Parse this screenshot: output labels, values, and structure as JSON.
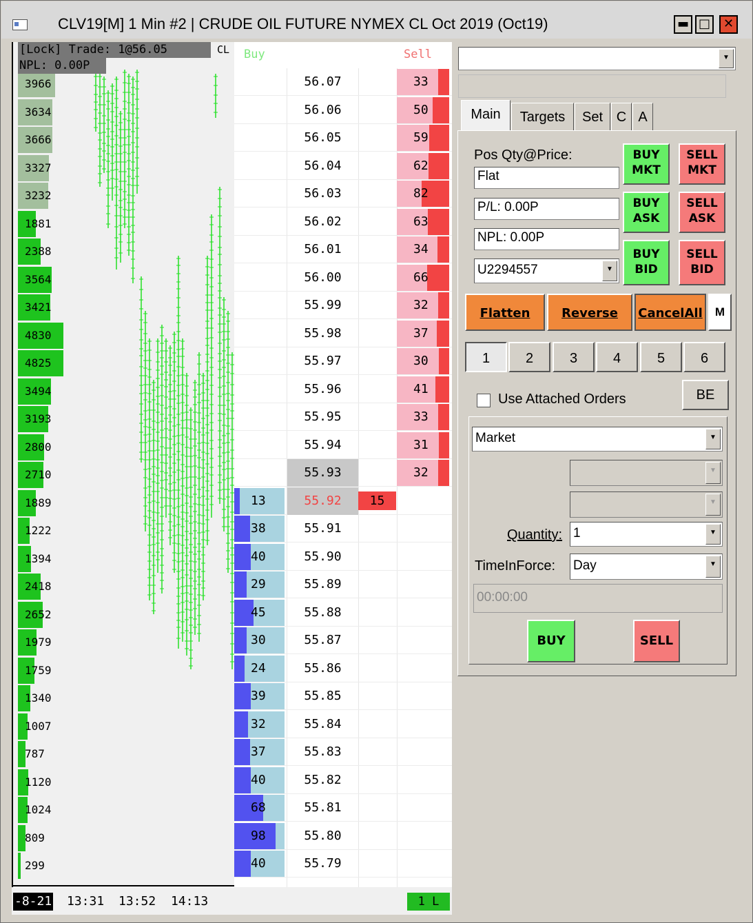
{
  "window": {
    "title": "CLV19[M]  1 Min   #2 | CRUDE OIL FUTURE NYMEX CL Oct 2019 (Oct19)",
    "minimize": "▬",
    "maximize": "□",
    "close": "✕"
  },
  "chart": {
    "lock_line": "[Lock] Trade: 1@56.05",
    "npl_line": "NPL: 0.00P",
    "symbol": "CL",
    "volume_profile": [
      {
        "price": "56.07",
        "volume": "3966"
      },
      {
        "price": "56.06",
        "volume": "3634"
      },
      {
        "price": "56.05",
        "volume": "3666"
      },
      {
        "price": "56.04",
        "volume": "3327"
      },
      {
        "price": "56.03",
        "volume": "3232"
      },
      {
        "price": "56.02",
        "volume": "1881"
      },
      {
        "price": "56.01",
        "volume": "2388"
      },
      {
        "price": "56.00",
        "volume": "3564"
      },
      {
        "price": "55.99",
        "volume": "3421"
      },
      {
        "price": "55.98",
        "volume": "4830"
      },
      {
        "price": "55.97",
        "volume": "4825"
      },
      {
        "price": "55.96",
        "volume": "3494"
      },
      {
        "price": "55.95",
        "volume": "3193"
      },
      {
        "price": "55.94",
        "volume": "2800"
      },
      {
        "price": "55.93",
        "volume": "2710"
      },
      {
        "price": "55.92",
        "volume": "1889"
      },
      {
        "price": "55.91",
        "volume": "1222"
      },
      {
        "price": "55.90",
        "volume": "1394"
      },
      {
        "price": "55.89",
        "volume": "2418"
      },
      {
        "price": "55.88",
        "volume": "2652"
      },
      {
        "price": "55.87",
        "volume": "1979"
      },
      {
        "price": "55.86",
        "volume": "1759"
      },
      {
        "price": "55.85",
        "volume": "1340"
      },
      {
        "price": "55.84",
        "volume": "1007"
      },
      {
        "price": "55.83",
        "volume": "787"
      },
      {
        "price": "55.82",
        "volume": "1120"
      },
      {
        "price": "55.81",
        "volume": "1024"
      },
      {
        "price": "55.80",
        "volume": "809"
      },
      {
        "price": "55.79",
        "volume": "299"
      }
    ],
    "time_labels": [
      "-8-21",
      "13:31",
      "13:52",
      "14:13"
    ]
  },
  "ladder": {
    "buy_header": "Buy",
    "sell_header": "Sell",
    "rows": [
      {
        "price": "56.07",
        "ask": "33"
      },
      {
        "price": "56.06",
        "ask": "50"
      },
      {
        "price": "56.05",
        "ask": "59"
      },
      {
        "price": "56.04",
        "ask": "62"
      },
      {
        "price": "56.03",
        "ask": "82"
      },
      {
        "price": "56.02",
        "ask": "63"
      },
      {
        "price": "56.01",
        "ask": "34"
      },
      {
        "price": "56.00",
        "ask": "66"
      },
      {
        "price": "55.99",
        "ask": "32"
      },
      {
        "price": "55.98",
        "ask": "37"
      },
      {
        "price": "55.97",
        "ask": "30"
      },
      {
        "price": "55.96",
        "ask": "41"
      },
      {
        "price": "55.95",
        "ask": "33"
      },
      {
        "price": "55.94",
        "ask": "31"
      },
      {
        "price": "55.93",
        "ask": "32"
      },
      {
        "price": "55.92",
        "bid": "13",
        "last_qty": "15"
      },
      {
        "price": "55.91",
        "bid": "38"
      },
      {
        "price": "55.90",
        "bid": "40"
      },
      {
        "price": "55.89",
        "bid": "29"
      },
      {
        "price": "55.88",
        "bid": "45"
      },
      {
        "price": "55.87",
        "bid": "30"
      },
      {
        "price": "55.86",
        "bid": "24"
      },
      {
        "price": "55.85",
        "bid": "39"
      },
      {
        "price": "55.84",
        "bid": "32"
      },
      {
        "price": "55.83",
        "bid": "37"
      },
      {
        "price": "55.82",
        "bid": "40"
      },
      {
        "price": "55.81",
        "bid": "68"
      },
      {
        "price": "55.80",
        "bid": "98"
      },
      {
        "price": "55.79",
        "bid": "40"
      }
    ],
    "footer_badge": "1 L",
    "colors": {
      "bid": "#5252ef",
      "bid_bg": "#a9d3e0",
      "ask": "#f24444",
      "ask_bg": "#f7b6c4",
      "last_trade": "#f24444",
      "volume": "#1ec31e"
    }
  },
  "panel": {
    "top_dropdown": "",
    "top_field": "",
    "tabs": [
      "Main",
      "Targets",
      "Set",
      "C",
      "A"
    ],
    "pos_label": "Pos Qty@Price:",
    "pos_value": "Flat",
    "pl_value": "P/L: 0.00P",
    "npl_value": "NPL: 0.00P",
    "account": "U2294557",
    "buy_mkt": [
      "BUY",
      "MKT"
    ],
    "sell_mkt": [
      "SELL",
      "MKT"
    ],
    "buy_ask": [
      "BUY",
      "ASK"
    ],
    "sell_ask": [
      "SELL",
      "ASK"
    ],
    "buy_bid": [
      "BUY",
      "BID"
    ],
    "sell_bid": [
      "SELL",
      "BID"
    ],
    "flatten": "Flatten",
    "reverse": "Reverse",
    "cancel_all": "CancelAll",
    "m_button": "M",
    "presets": [
      "1",
      "2",
      "3",
      "4",
      "5",
      "6"
    ],
    "use_attached": "Use Attached Orders",
    "be_button": "BE",
    "order_type": "Market",
    "quantity_label": "Quantity:",
    "quantity": "1",
    "tif_label": "TimeInForce:",
    "tif": "Day",
    "time_field": "00:00:00",
    "buy_button": "BUY",
    "sell_button": "SELL"
  }
}
